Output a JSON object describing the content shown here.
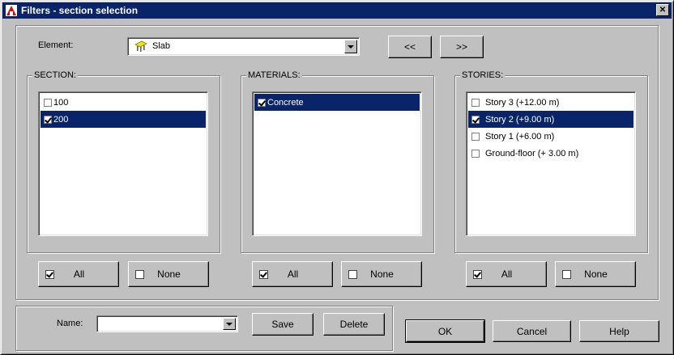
{
  "window": {
    "title": "Filters - section selection",
    "close_glyph": "✕"
  },
  "element": {
    "label": "Element:",
    "value": "Slab",
    "icon": "slab-icon",
    "nav_prev": "<<",
    "nav_next": ">>"
  },
  "section": {
    "title": "SECTION:",
    "items": [
      {
        "label": "100",
        "checked": false,
        "selected": false
      },
      {
        "label": "200",
        "checked": true,
        "selected": true
      }
    ],
    "all_label": "All",
    "none_label": "None"
  },
  "materials": {
    "title": "MATERIALS:",
    "items": [
      {
        "label": "Concrete",
        "checked": true,
        "selected": true
      }
    ],
    "all_label": "All",
    "none_label": "None"
  },
  "stories": {
    "title": "STORIES:",
    "items": [
      {
        "label": "Story 3 (+12.00 m)",
        "checked": false,
        "selected": false
      },
      {
        "label": "Story 2 (+9.00 m)",
        "checked": true,
        "selected": true
      },
      {
        "label": "Story 1 (+6.00 m)",
        "checked": false,
        "selected": false
      },
      {
        "label": "Ground-floor (+ 3.00 m)",
        "checked": false,
        "selected": false
      }
    ],
    "all_label": "All",
    "none_label": "None"
  },
  "name": {
    "label": "Name:",
    "value": "",
    "save_label": "Save",
    "delete_label": "Delete"
  },
  "actions": {
    "ok_label": "OK",
    "cancel_label": "Cancel",
    "help_label": "Help"
  },
  "colors": {
    "title_bar": "#0a246a",
    "face": "#c0c0c0",
    "selection": "#0a246a"
  }
}
